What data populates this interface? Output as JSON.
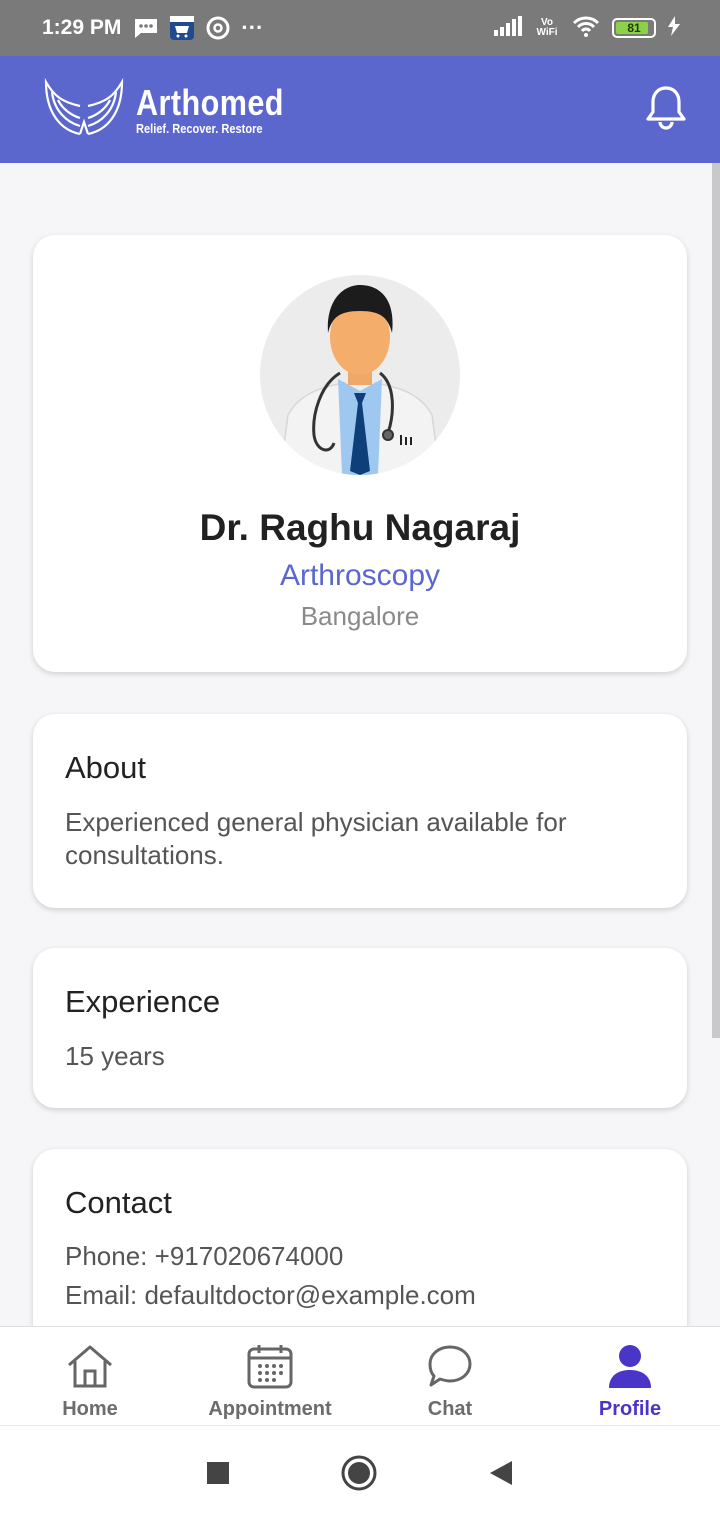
{
  "status_bar": {
    "time": "1:29 PM",
    "battery": "81",
    "dots": "···",
    "network": "Vo WiFi"
  },
  "app_bar": {
    "brand_name": "Arthomed",
    "brand_tagline": "Relief. Recover. Restore"
  },
  "profile": {
    "name": "Dr. Raghu Nagaraj",
    "specialty": "Arthroscopy",
    "city": "Bangalore"
  },
  "about": {
    "title": "About",
    "text": "Experienced general physician available for consultations."
  },
  "experience": {
    "title": "Experience",
    "text": "15 years"
  },
  "contact": {
    "title": "Contact",
    "phone": "Phone: +917020674000",
    "email": "Email: defaultdoctor@example.com"
  },
  "bottom_nav": {
    "items": [
      {
        "label": "Home",
        "icon": "home-icon"
      },
      {
        "label": "Appointment",
        "icon": "calendar-icon"
      },
      {
        "label": "Chat",
        "icon": "chat-icon"
      },
      {
        "label": "Profile",
        "icon": "person-icon"
      }
    ],
    "active_index": 3
  },
  "colors": {
    "brand": "#5b67cd",
    "active_tab": "#4a35c9",
    "status_bar": "#7a7a7a"
  }
}
